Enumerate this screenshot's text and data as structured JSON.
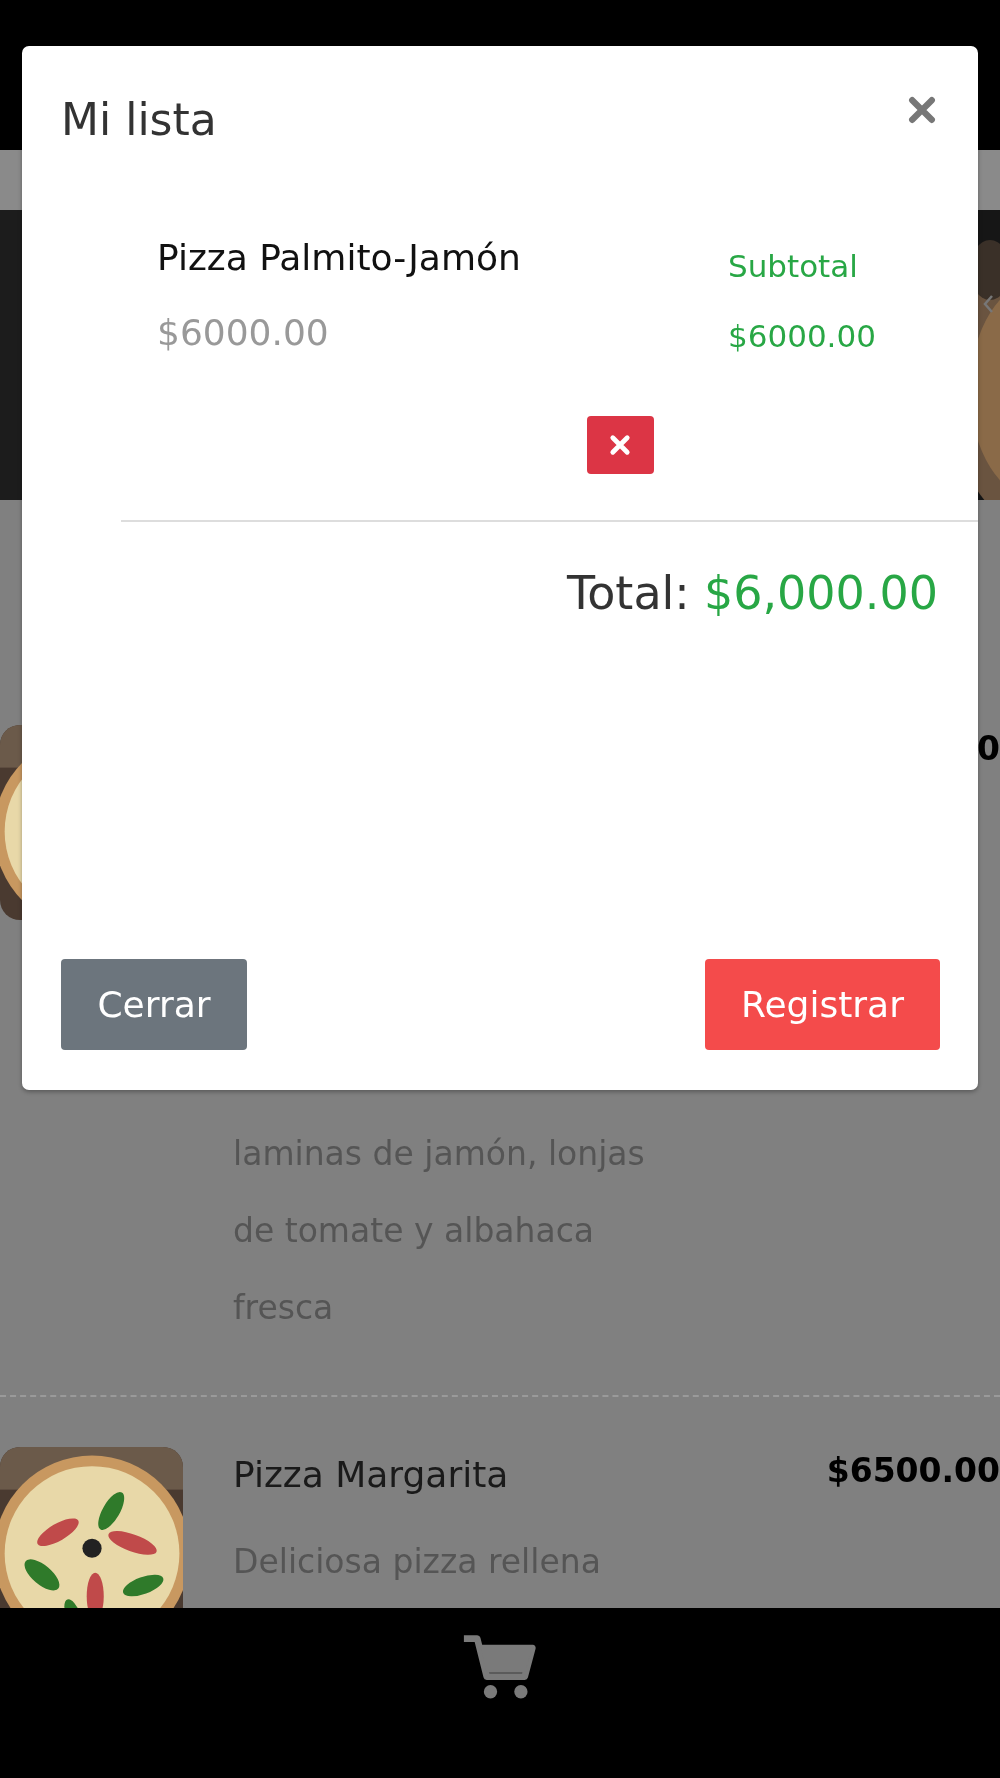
{
  "background": {
    "menu_items": [
      {
        "price": "0",
        "description_lines": [
          "laminas de jamón, lonjas",
          "de tomate y albahaca",
          "fresca"
        ]
      },
      {
        "name": "Pizza Margarita",
        "price": "$6500.00",
        "description_lines": [
          "Deliciosa pizza rellena"
        ]
      }
    ]
  },
  "modal": {
    "title": "Mi lista",
    "items": [
      {
        "name": "Pizza Palmito-Jamón",
        "price": "$6000.00",
        "subtotal_label": "Subtotal",
        "subtotal": "$6000.00"
      }
    ],
    "total_label": "Total:",
    "total": "$6,000.00",
    "buttons": [
      {
        "label": "Cerrar",
        "kind": "secondary"
      },
      {
        "label": "Registrar",
        "kind": "primary"
      }
    ]
  }
}
